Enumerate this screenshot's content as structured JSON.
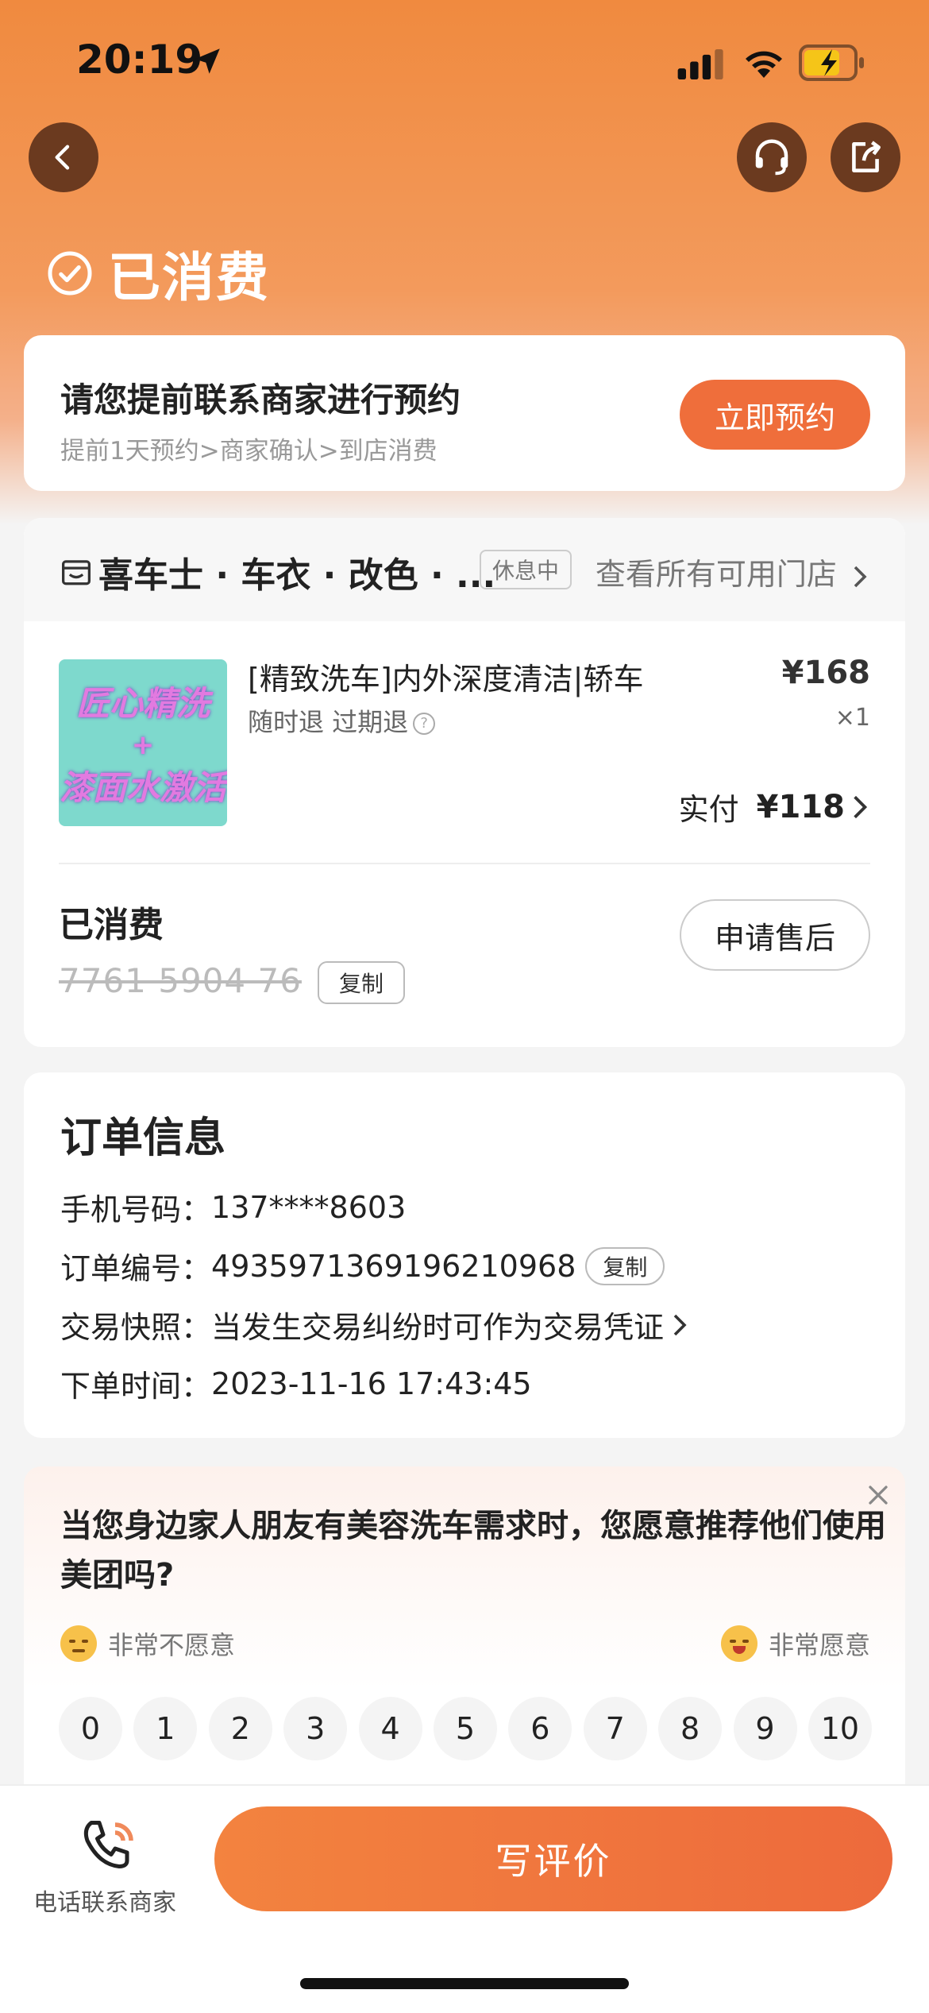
{
  "status_bar": {
    "time": "20:19"
  },
  "header": {
    "status_title": "已消费"
  },
  "appointment": {
    "title": "请您提前联系商家进行预约",
    "subtitle": "提前1天预约>商家确认>到店消费",
    "button": "立即预约"
  },
  "store": {
    "name": "喜车士 · 车衣 · 改色 · ...",
    "status_badge": "休息中",
    "view_all": "查看所有可用门店"
  },
  "goods": {
    "image_text": [
      "匠心精洗",
      "+",
      "漆面水激活"
    ],
    "title": "[精致洗车]内外深度清洁|轿车",
    "tags": "随时退  过期退",
    "price": "¥168",
    "quantity": "×1",
    "paid_label": "实付",
    "paid_amount": "¥118"
  },
  "voucher": {
    "status": "已消费",
    "code": "7761 5904 76",
    "copy_label": "复制",
    "after_sale": "申请售后"
  },
  "order": {
    "title": "订单信息",
    "phone_label": "手机号码：",
    "phone": "137****8603",
    "number_label": "订单编号：",
    "number": "4935971369196210968",
    "copy_label": "复制",
    "snapshot_label": "交易快照：",
    "snapshot": "当发生交易纠纷时可作为交易凭证",
    "time_label": "下单时间：",
    "time": "2023-11-16 17:43:45"
  },
  "survey": {
    "question": "当您身边家人朋友有美容洗车需求时，您愿意推荐他们使用美团吗?",
    "low_label": "非常不愿意",
    "high_label": "非常愿意",
    "scores": [
      "0",
      "1",
      "2",
      "3",
      "4",
      "5",
      "6",
      "7",
      "8",
      "9",
      "10"
    ]
  },
  "bottom": {
    "phone_label": "电话联系商家",
    "review_button": "写评价"
  },
  "colors": {
    "accent": "#ef6e3b",
    "header_gradient_top": "#f08a3f",
    "icon_button_bg": "#6b3a1f",
    "goods_image_bg": "#7ed9cd"
  }
}
